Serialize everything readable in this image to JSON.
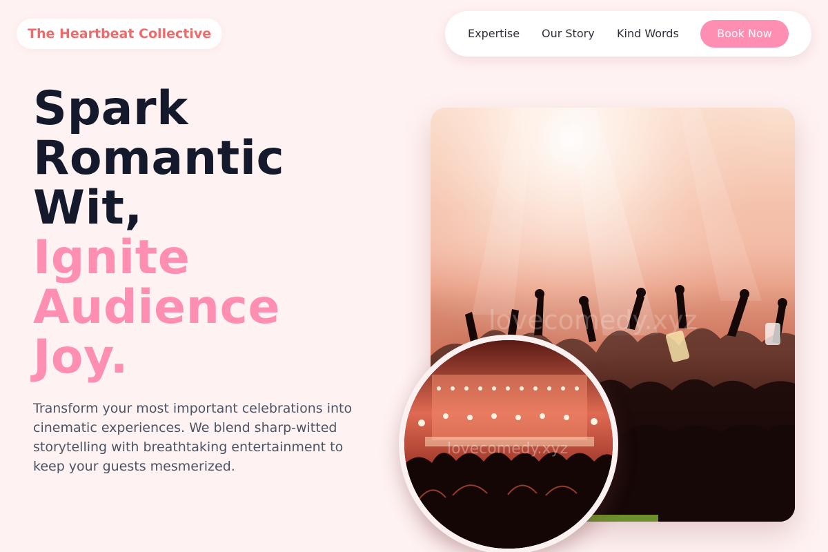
{
  "brand": {
    "name": "The Heartbeat Collective"
  },
  "nav": {
    "links": [
      "Expertise",
      "Our Story",
      "Kind Words"
    ],
    "cta": "Book Now"
  },
  "hero": {
    "headline_dark": [
      "Spark",
      "Romantic",
      "Wit,"
    ],
    "headline_accent": [
      "Ignite",
      "Audience",
      "Joy."
    ],
    "description": "Transform your most important celebrations into cinematic experiences. We blend sharp-witted storytelling with breathtaking entertainment to keep your guests mesmerized."
  },
  "images": {
    "main_photo": {
      "subject": "concert crowd with raised hands under stage haze",
      "watermark": "lovecomedy.xyz"
    },
    "circle_photo": {
      "subject": "audience silhouettes facing lit stage",
      "watermark": "lovecomedy.xyz"
    }
  },
  "colors": {
    "background": "#fff2f2",
    "brand_text": "#ee6b6b",
    "accent_pink": "#ff8fb2",
    "headline_dark": "#141a2b",
    "body_text": "#4c5363"
  }
}
